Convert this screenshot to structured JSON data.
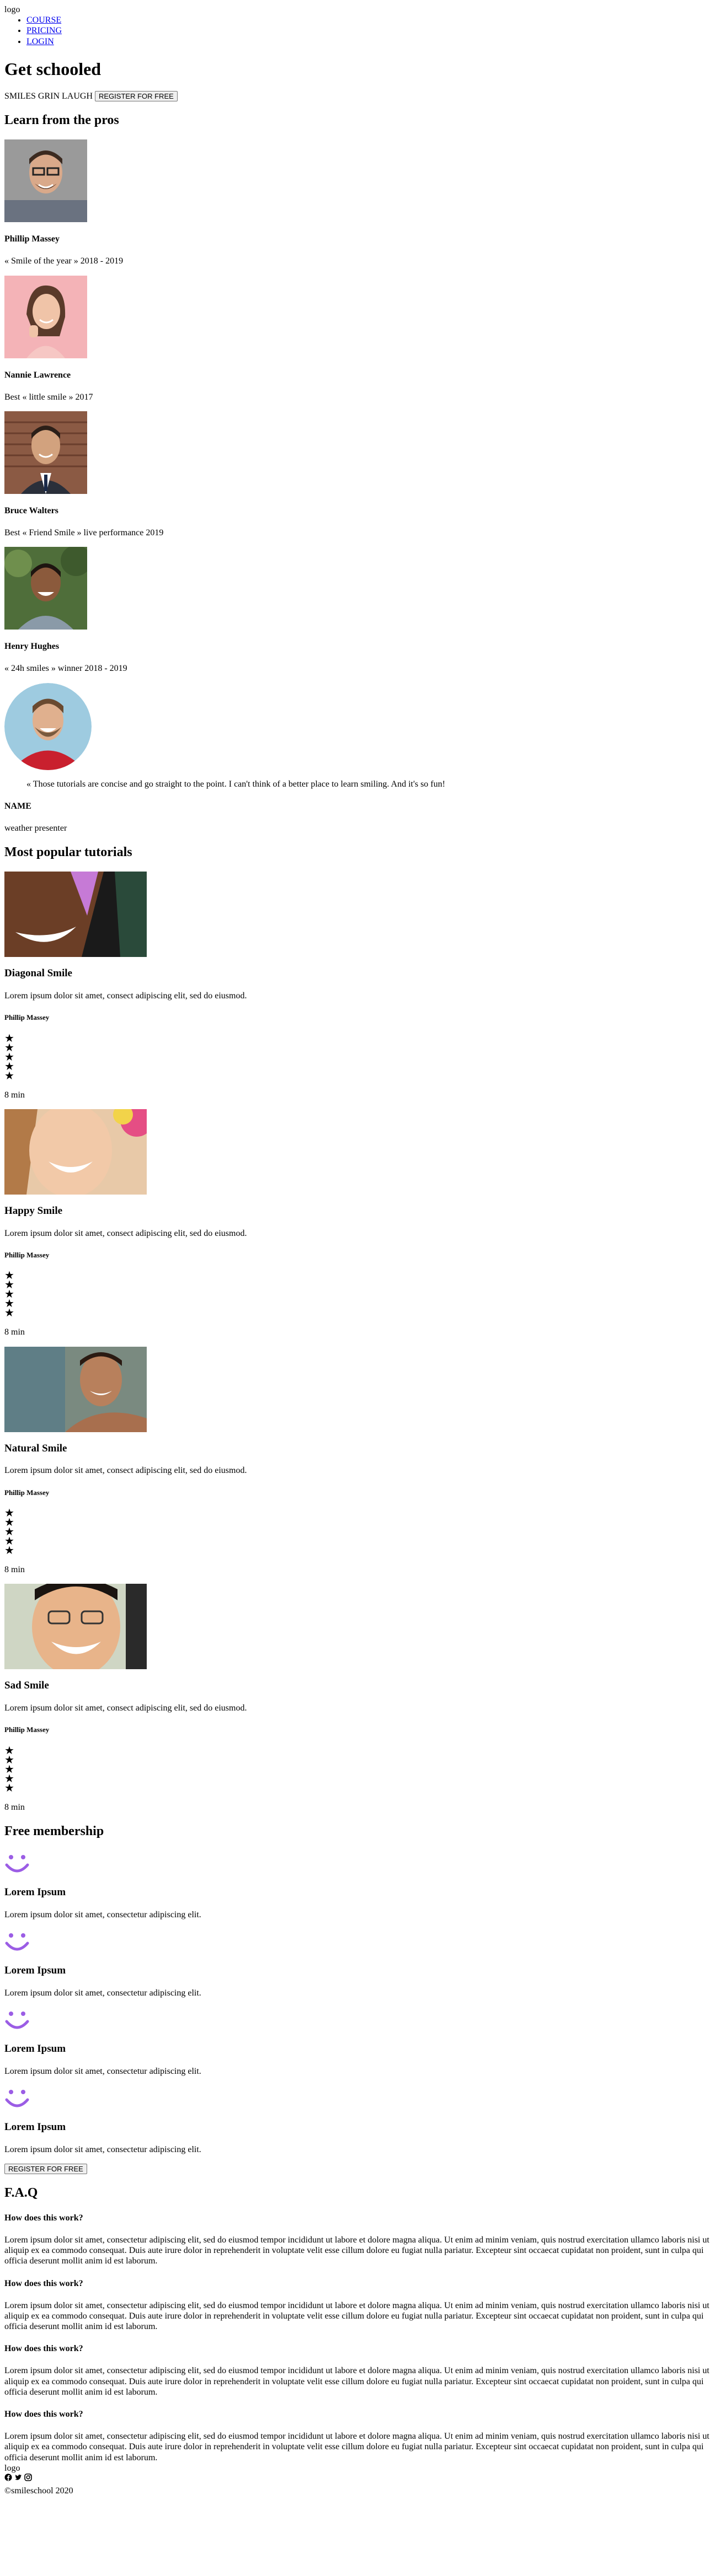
{
  "header": {
    "logo": "logo",
    "nav": [
      "COURSE",
      "PRICING",
      "LOGIN"
    ]
  },
  "hero": {
    "title": "Get schooled",
    "tagline": "SMILES GRIN LAUGH",
    "cta": "REGISTER FOR FREE"
  },
  "pros": {
    "heading": "Learn from the pros",
    "items": [
      {
        "name": "Phillip Massey",
        "award": "« Smile of the year » 2018 - 2019"
      },
      {
        "name": "Nannie Lawrence",
        "award": "Best « little smile » 2017"
      },
      {
        "name": "Bruce Walters",
        "award": "Best « Friend Smile » live performance 2019"
      },
      {
        "name": "Henry Hughes",
        "award": "« 24h smiles » winner 2018 - 2019"
      }
    ]
  },
  "testimonial": {
    "quote": "« Those tutorials are concise and go straight to the point. I can't think of a better place to learn smiling. And it's so fun!",
    "name": "NAME",
    "role": "weather presenter"
  },
  "tutorials": {
    "heading": "Most popular tutorials",
    "items": [
      {
        "title": "Diagonal Smile",
        "desc": "Lorem ipsum dolor sit amet, consect adipiscing elit, sed do eiusmod.",
        "author": "Phillip Massey",
        "rating": 5,
        "duration": "8 min"
      },
      {
        "title": "Happy Smile",
        "desc": "Lorem ipsum dolor sit amet, consect adipiscing elit, sed do eiusmod.",
        "author": "Phillip Massey",
        "rating": 5,
        "duration": "8 min"
      },
      {
        "title": "Natural Smile",
        "desc": "Lorem ipsum dolor sit amet, consect adipiscing elit, sed do eiusmod.",
        "author": "Phillip Massey",
        "rating": 5,
        "duration": "8 min"
      },
      {
        "title": "Sad Smile",
        "desc": "Lorem ipsum dolor sit amet, consect adipiscing elit, sed do eiusmod.",
        "author": "Phillip Massey",
        "rating": 5,
        "duration": "8 min"
      }
    ]
  },
  "membership": {
    "heading": "Free membership",
    "items": [
      {
        "title": "Lorem Ipsum",
        "text": "Lorem ipsum dolor sit amet, consectetur adipiscing elit."
      },
      {
        "title": "Lorem Ipsum",
        "text": "Lorem ipsum dolor sit amet, consectetur adipiscing elit."
      },
      {
        "title": "Lorem Ipsum",
        "text": "Lorem ipsum dolor sit amet, consectetur adipiscing elit."
      },
      {
        "title": "Lorem Ipsum",
        "text": "Lorem ipsum dolor sit amet, consectetur adipiscing elit."
      }
    ],
    "cta": "REGISTER FOR FREE"
  },
  "faq": {
    "heading": "F.A.Q",
    "items": [
      {
        "q": "How does this work?",
        "a": "Lorem ipsum dolor sit amet, consectetur adipiscing elit, sed do eiusmod tempor incididunt ut labore et dolore magna aliqua. Ut enim ad minim veniam, quis nostrud exercitation ullamco laboris nisi ut aliquip ex ea commodo consequat. Duis aute irure dolor in reprehenderit in voluptate velit esse cillum dolore eu fugiat nulla pariatur. Excepteur sint occaecat cupidatat non proident, sunt in culpa qui officia deserunt mollit anim id est laborum."
      },
      {
        "q": "How does this work?",
        "a": "Lorem ipsum dolor sit amet, consectetur adipiscing elit, sed do eiusmod tempor incididunt ut labore et dolore magna aliqua. Ut enim ad minim veniam, quis nostrud exercitation ullamco laboris nisi ut aliquip ex ea commodo consequat. Duis aute irure dolor in reprehenderit in voluptate velit esse cillum dolore eu fugiat nulla pariatur. Excepteur sint occaecat cupidatat non proident, sunt in culpa qui officia deserunt mollit anim id est laborum."
      },
      {
        "q": "How does this work?",
        "a": "Lorem ipsum dolor sit amet, consectetur adipiscing elit, sed do eiusmod tempor incididunt ut labore et dolore magna aliqua. Ut enim ad minim veniam, quis nostrud exercitation ullamco laboris nisi ut aliquip ex ea commodo consequat. Duis aute irure dolor in reprehenderit in voluptate velit esse cillum dolore eu fugiat nulla pariatur. Excepteur sint occaecat cupidatat non proident, sunt in culpa qui officia deserunt mollit anim id est laborum."
      },
      {
        "q": "How does this work?",
        "a": "Lorem ipsum dolor sit amet, consectetur adipiscing elit, sed do eiusmod tempor incididunt ut labore et dolore magna aliqua. Ut enim ad minim veniam, quis nostrud exercitation ullamco laboris nisi ut aliquip ex ea commodo consequat. Duis aute irure dolor in reprehenderit in voluptate velit esse cillum dolore eu fugiat nulla pariatur. Excepteur sint occaecat cupidatat non proident, sunt in culpa qui officia deserunt mollit anim id est laborum."
      }
    ]
  },
  "footer": {
    "logo": "logo",
    "social_icons": [
      "facebook-icon",
      "twitter-icon",
      "instagram-icon"
    ],
    "copyright": "©smileschool 2020"
  },
  "colors": {
    "link": "#0000ee",
    "smiley": "#9b5de5"
  }
}
